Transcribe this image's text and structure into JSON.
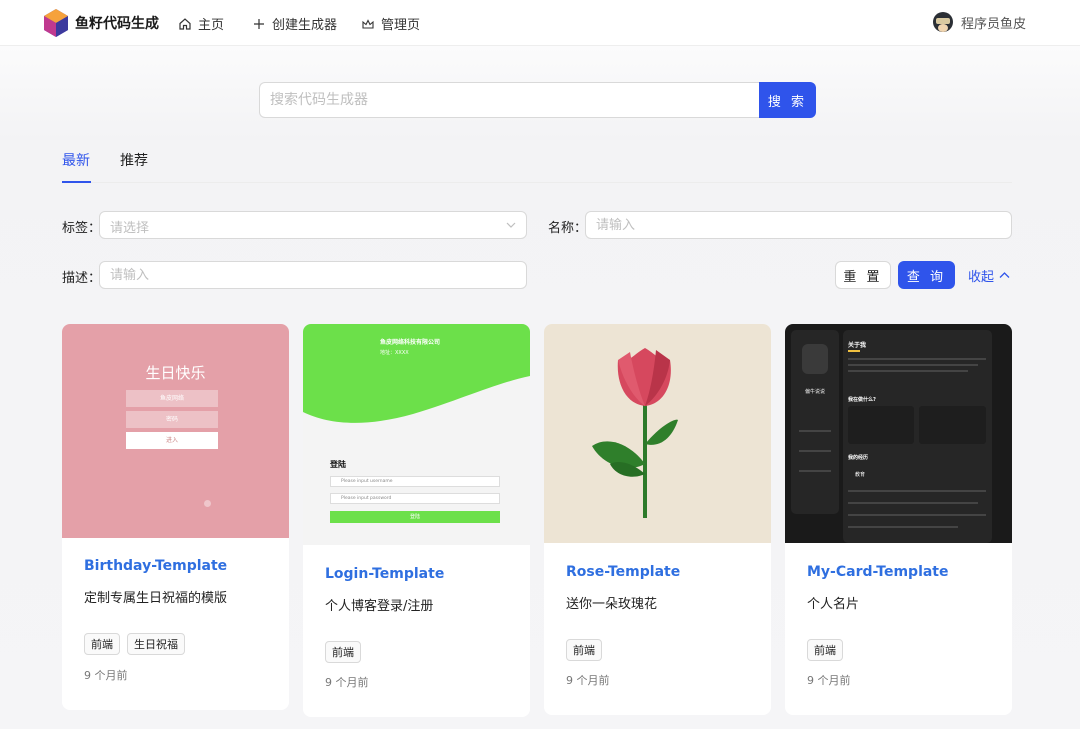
{
  "header": {
    "app_title": "鱼籽代码生成",
    "nav": [
      {
        "label": "主页",
        "icon": "home-icon"
      },
      {
        "label": "创建生成器",
        "icon": "plus-icon"
      },
      {
        "label": "管理页",
        "icon": "crown-icon"
      }
    ],
    "user_name": "程序员鱼皮"
  },
  "search": {
    "placeholder": "搜索代码生成器",
    "button_label": "搜 索"
  },
  "tabs": [
    {
      "label": "最新",
      "active": true
    },
    {
      "label": "推荐",
      "active": false
    }
  ],
  "filters": {
    "tag_label": "标签：",
    "tag_placeholder": "请选择",
    "name_label": "名称：",
    "name_placeholder": "请输入",
    "desc_label": "描述：",
    "desc_placeholder": "请输入",
    "reset_label": "重 置",
    "query_label": "查 询",
    "collapse_label": "收起"
  },
  "cards": [
    {
      "title": "Birthday-Template",
      "description": "定制专属生日祝福的模版",
      "tags": [
        "前端",
        "生日祝福"
      ],
      "time": "9 个月前",
      "cover_text": {
        "heading": "生日快乐",
        "field1": "鱼皮网络",
        "field2": "密码",
        "button": "进入"
      }
    },
    {
      "title": "Login-Template",
      "description": "个人博客登录/注册",
      "tags": [
        "前端"
      ],
      "time": "9 个月前",
      "cover_text": {
        "company": "鱼皮网络科技有限公司",
        "sub": "地址：XXXX",
        "heading": "登陆",
        "user_placeholder": "Please input username",
        "pass_placeholder": "Please input password",
        "button": "登陆"
      }
    },
    {
      "title": "Rose-Template",
      "description": "送你一朵玫瑰花",
      "tags": [
        "前端"
      ],
      "time": "9 个月前"
    },
    {
      "title": "My-Card-Template",
      "description": "个人名片",
      "tags": [
        "前端"
      ],
      "time": "9 个月前",
      "cover_text": {
        "about": "关于我",
        "name": "偏牛说说",
        "doing": "我在做什么?",
        "experience": "我的经历",
        "edu": "教育"
      }
    }
  ],
  "colors": {
    "primary": "#2f54eb",
    "link_title": "#2f6fe0",
    "birthday_bg": "#e4a0a8",
    "login_green": "#6ce04a",
    "rose_bg": "#ede4d4",
    "card_dark": "#1a1a1a"
  }
}
